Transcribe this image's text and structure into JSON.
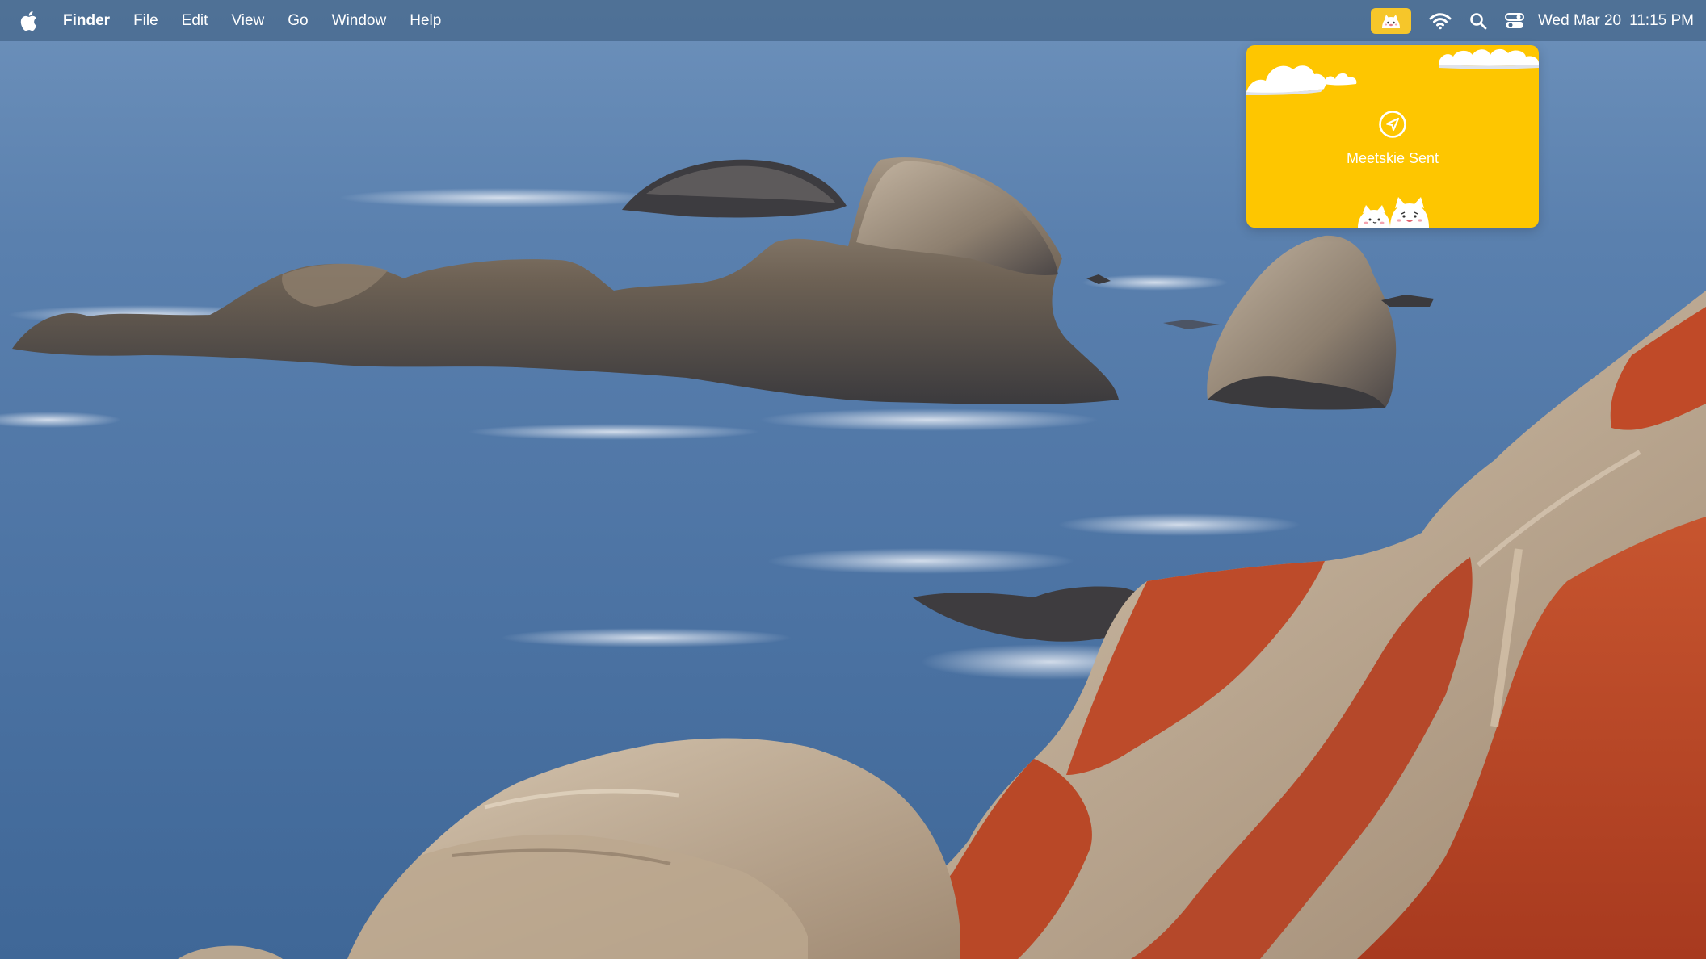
{
  "menubar": {
    "apple_icon": "apple-logo-icon",
    "app_name": "Finder",
    "items": [
      {
        "label": "File"
      },
      {
        "label": "Edit"
      },
      {
        "label": "View"
      },
      {
        "label": "Go"
      },
      {
        "label": "Window"
      },
      {
        "label": "Help"
      }
    ],
    "status_icons": [
      "meetskie-mascot-icon",
      "wifi-icon",
      "search-icon",
      "control-center-icon"
    ],
    "clock": {
      "date": "Wed Mar 20",
      "time": "11:15 PM"
    }
  },
  "notification": {
    "icon": "paper-plane-icon",
    "label": "Meetskie Sent",
    "background_color": "#fec600"
  },
  "colors": {
    "menubar_bg": "#46688c",
    "text": "#ffffff",
    "accent_yellow": "#fec600"
  }
}
